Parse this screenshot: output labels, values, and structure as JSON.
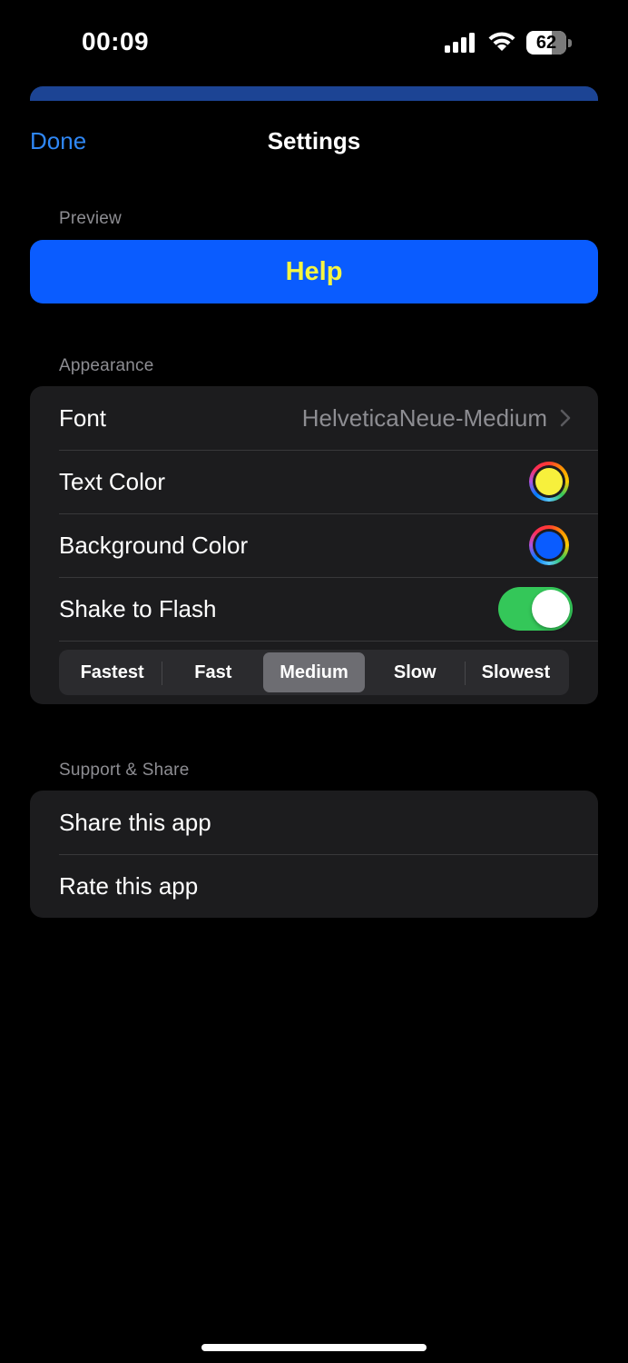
{
  "status_bar": {
    "time": "00:09",
    "battery_level": "62"
  },
  "nav": {
    "done_label": "Done",
    "title": "Settings"
  },
  "preview": {
    "header": "Preview",
    "text": "Help",
    "text_color": "#f5f542",
    "background_color": "#0a5cff"
  },
  "appearance": {
    "header": "Appearance",
    "font_label": "Font",
    "font_value": "HelveticaNeue-Medium",
    "text_color_label": "Text Color",
    "text_color_value": "#f7f03c",
    "background_color_label": "Background Color",
    "background_color_value": "#0a5cff",
    "shake_label": "Shake to Flash",
    "shake_enabled": true,
    "speed_options": [
      "Fastest",
      "Fast",
      "Medium",
      "Slow",
      "Slowest"
    ],
    "speed_selected": "Medium"
  },
  "support": {
    "header": "Support & Share",
    "share_label": "Share this app",
    "rate_label": "Rate this app"
  },
  "colors": {
    "accent": "#2f87f5",
    "toggle_on": "#34c759",
    "sheet_strip": "#1c4494"
  }
}
